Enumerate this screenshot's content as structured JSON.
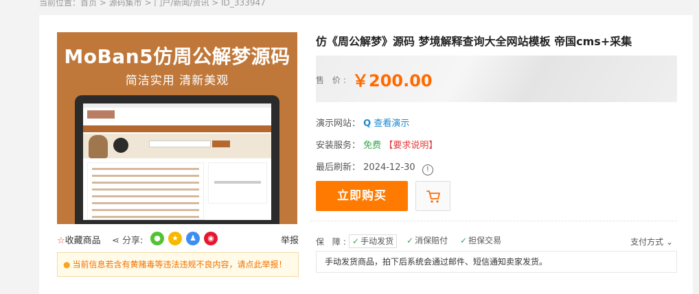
{
  "breadcrumb": "当前位置：首页 > 源码集市 > 门户/新闻/资讯 > ID_333947",
  "image": {
    "headline": "MoBan5仿周公解梦源码",
    "subline": "简洁实用  清新美观"
  },
  "actions": {
    "favorite": "收藏商品",
    "share": "分享:",
    "report": "举报",
    "share_icons": [
      "wechat-icon",
      "qzone-icon",
      "qq-icon",
      "weibo-icon"
    ]
  },
  "warning": "当前信息若含有黄赌毒等违法违规不良内容，请点此举报！",
  "product": {
    "title": "仿《周公解梦》源码 梦境解释查询大全网站模板 帝国cms+采集",
    "price_label": "售 价:",
    "price": "￥200.00"
  },
  "info": {
    "demo_label": "演示网站：",
    "demo_link": "查看演示",
    "install_label": "安装服务：",
    "install_value": "免费",
    "install_req": "【要求说明】",
    "refresh_label": "最后刷新：",
    "refresh_date": "2024-12-30"
  },
  "buttons": {
    "buy": "立即购买"
  },
  "guarantee": {
    "label": "保 障:",
    "tags": [
      "手动发货",
      "消保赔付",
      "担保交易"
    ],
    "pay": "支付方式",
    "note": "手动发货商品，拍下后系统会通过邮件、短信通知卖家发货。"
  },
  "colors": {
    "accent": "#ff7a00",
    "price": "#ff6a00",
    "link": "#1a88d2",
    "free": "#32a64e",
    "alert": "#e4393c",
    "image_bg": "#c0783a"
  }
}
